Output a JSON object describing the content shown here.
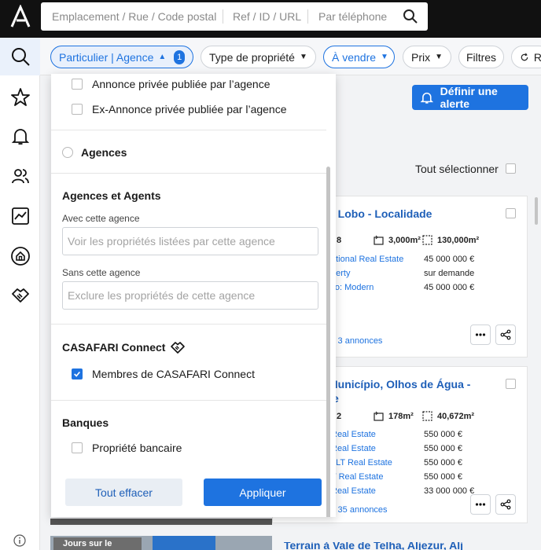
{
  "search": {
    "location_placeholder": "Emplacement / Rue / Code postal",
    "ref_placeholder": "Ref / ID / URL",
    "phone_placeholder": "Par téléphone"
  },
  "filters": {
    "owner": "Particulier | Agence",
    "owner_count": "1",
    "property_type": "Type de propriété",
    "transaction": "À vendre",
    "price": "Prix",
    "filters": "Filtres",
    "reset": "R"
  },
  "actions": {
    "alert": "Définir une alerte",
    "select_all": "Tout sélectionner"
  },
  "dropdown": {
    "opt_private_agency": "Annonce privée publiée par l’agence",
    "opt_ex_private": "Ex-Annonce privée publiée par l’agence",
    "opt_agencies": "Agences",
    "section_agents": "Agences et Agents",
    "with_agency_label": "Avec cette agence",
    "with_agency_placeholder": "Voir les propriétés listées par cette agence",
    "without_agency_label": "Sans cette agence",
    "without_agency_placeholder": "Exclure les propriétés de cette agence",
    "section_connect": "CASAFARI Connect",
    "connect_members": "Membres de CASAFARI Connect",
    "section_banks": "Banques",
    "bank_property": "Propriété bancaire",
    "clear": "Tout effacer",
    "apply": "Appliquer"
  },
  "cards": [
    {
      "title": "e do Lobo - Localidade",
      "stats": {
        "rooms": "8",
        "area": "3,000m²",
        "plot": "130,000m²"
      },
      "rows": [
        {
          "source": "ational Real Estate",
          "price": "45 000 000 €"
        },
        {
          "source": "perty",
          "price": "sur demande"
        },
        {
          "source": "lio: Modern",
          "price": "45 000 000 €"
        }
      ],
      "more": "s 3 annonces"
    },
    {
      "title": " do Município, Olhos de Água -",
      "title2": "e",
      "stats": {
        "rooms": "2",
        "area": "178m²",
        "plot": "40,672m²"
      },
      "rows": [
        {
          "source": "Real Estate",
          "price": "550 000 €"
        },
        {
          "source": " Real Estate",
          "price": "550 000 €"
        },
        {
          "source": ": LT Real Estate",
          "price": "550 000 €"
        },
        {
          "source": "T Real Estate",
          "price": "550 000 €"
        },
        {
          "source": " Real Estate",
          "price": "33 000 000 €"
        }
      ],
      "more": "s 35 annonces"
    }
  ],
  "bottom": {
    "tag": "Jours sur le",
    "title": "Terrain à Vale de Telha, Aljezur, Alj"
  }
}
